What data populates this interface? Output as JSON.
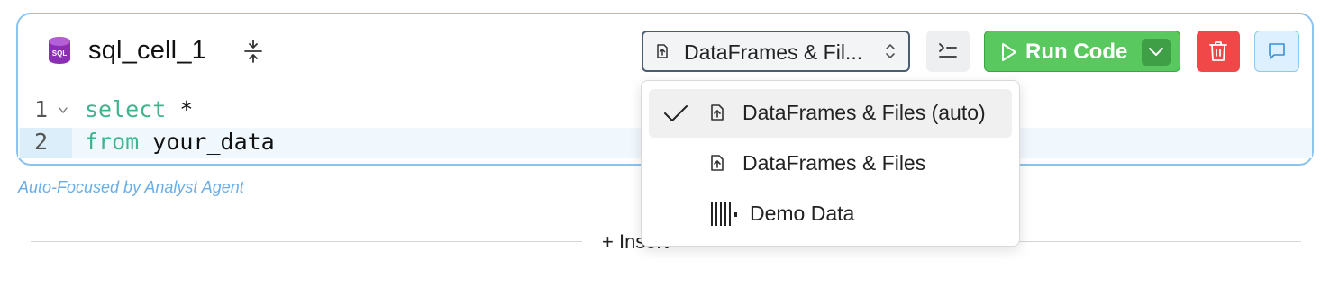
{
  "cell": {
    "title": "sql_cell_1",
    "db_icon_text": "SQL",
    "source_select": {
      "value": "DataFrames & Fil..."
    },
    "run_button": {
      "label": "Run Code"
    },
    "code_lines": [
      {
        "number": "1",
        "keyword": "select",
        "rest": " *"
      },
      {
        "number": "2",
        "keyword": "from",
        "rest": " your_data"
      }
    ]
  },
  "agent_note": "Auto-Focused by Analyst Agent",
  "insert_label": "+ Insert",
  "dropdown": {
    "options": [
      {
        "label": "DataFrames & Files (auto)",
        "icon": "upload-file-icon",
        "selected": true
      },
      {
        "label": "DataFrames & Files",
        "icon": "upload-file-icon",
        "selected": false
      },
      {
        "label": "Demo Data",
        "icon": "barcode-icon",
        "selected": false
      }
    ]
  },
  "colors": {
    "cell_border": "#8cc3f0",
    "run_green": "#59c95f",
    "delete_red": "#f04848",
    "keyword": "#3fb48f",
    "agent_note": "#6aaee8"
  }
}
